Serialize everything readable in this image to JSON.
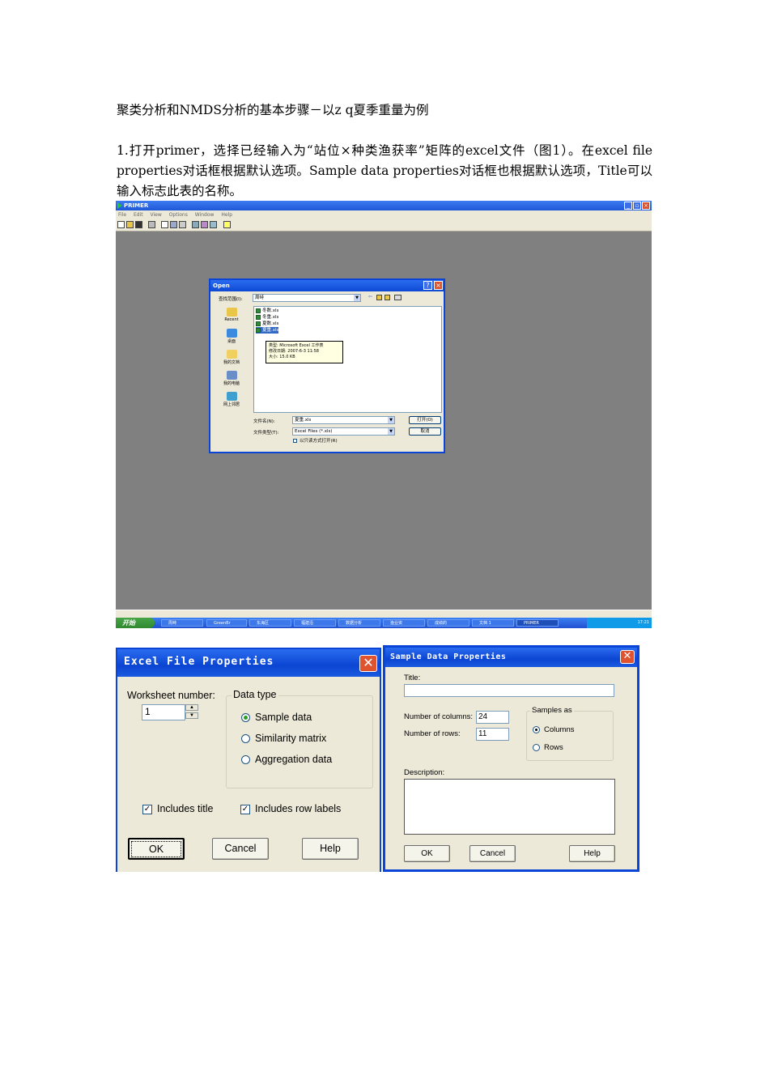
{
  "doc": {
    "title": "聚类分析和NMDS分析的基本步骤－以z q夏季重量为例",
    "paragraph": "1.打开primer，选择已经输入为“站位×种类渔获率”矩阵的excel文件（图1）。在excel file properties对话框根据默认选项。Sample data properties对话框也根据默认选项，Title可以输入标志此表的名称。"
  },
  "primer": {
    "title": "PRIMER",
    "menu": [
      "File",
      "Edit",
      "View",
      "Options",
      "Window",
      "Help"
    ],
    "open_dialog": {
      "title": "Open",
      "look_in_label": "查找范围(I):",
      "look_in_value": "周峙",
      "places": [
        "Recent",
        "桌面",
        "我的文档",
        "我的电脑",
        "网上邻居"
      ],
      "files": [
        "冬数.xls",
        "冬重.xls",
        "夏数.xls",
        "夏重.xls"
      ],
      "selected_file": "夏重.xls",
      "tooltip": [
        "类型: Microsoft Excel 工作表",
        "修改日期: 2007-6-3 11:58",
        "大小: 15.0 KB"
      ],
      "filename_label": "文件名(N):",
      "filename_value": "夏重.xls",
      "filetype_label": "文件类型(T):",
      "filetype_value": "Excel Files (*.xls)",
      "readonly_label": "以只读方式打开(R)",
      "open_button": "打开(O)",
      "cancel_button": "取消"
    },
    "taskbar": {
      "start": "开始",
      "items": [
        "周峙",
        "GreenBr",
        "东海区",
        "福建沿",
        "数据分析",
        "渔业资",
        "成绩的",
        "文档 1",
        "PRIMER"
      ],
      "clock": "17:21"
    }
  },
  "excel_props": {
    "title": "Excel File Properties",
    "worksheet_label": "Worksheet number:",
    "worksheet_value": "1",
    "data_type_legend": "Data type",
    "data_types": [
      "Sample data",
      "Similarity matrix",
      "Aggregation data"
    ],
    "selected_data_type": "Sample data",
    "includes_title": "Includes title",
    "includes_row_labels": "Includes row labels",
    "ok": "OK",
    "cancel": "Cancel",
    "help": "Help"
  },
  "sample_props": {
    "title": "Sample Data Properties",
    "title_label": "Title:",
    "title_value": "",
    "columns_label": "Number of columns:",
    "columns_value": "24",
    "rows_label": "Number of rows:",
    "rows_value": "11",
    "samples_as_legend": "Samples as",
    "samples_as_options": [
      "Columns",
      "Rows"
    ],
    "selected_samples_as": "Columns",
    "description_label": "Description:",
    "ok": "OK",
    "cancel": "Cancel",
    "help": "Help"
  },
  "colors": {
    "xp_blue": "#0a45d8",
    "dialog_bg": "#ece9d8",
    "workspace_gray": "#808080",
    "close_red": "#e0532f"
  }
}
